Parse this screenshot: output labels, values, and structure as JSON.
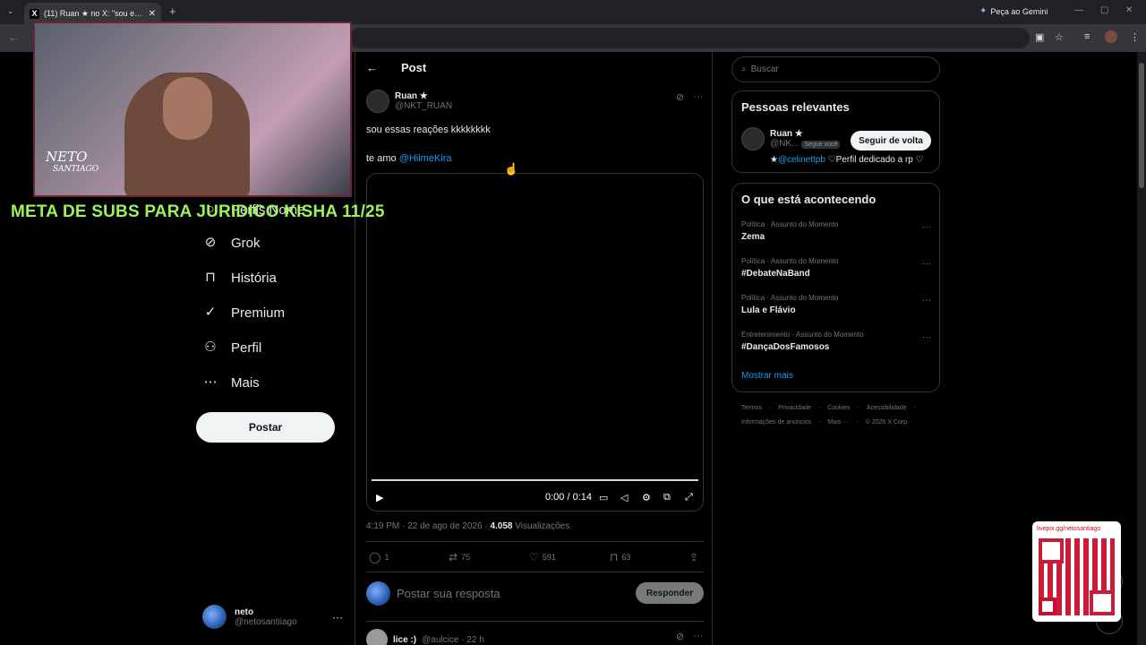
{
  "browser": {
    "tab_title": "(11) Ruan ★ no X: \"sou essas re",
    "tab_favicon": "X",
    "gemini_label": "Peça ao Gemini"
  },
  "overlay": {
    "banner": "META DE SUBS PARA JURIDICO KISHA 11/25",
    "webcam_logo_line1": "NETO",
    "webcam_logo_line2": "SANTIAGO",
    "qr_url": "livepix.gg/netosantiago"
  },
  "nav": {
    "items": [
      {
        "label": "Perfis Nome",
        "icon": "search-icon"
      },
      {
        "label": "Grok",
        "icon": "grok-icon"
      },
      {
        "label": "História",
        "icon": "bookmark-icon"
      },
      {
        "label": "Premium",
        "icon": "verified-icon"
      },
      {
        "label": "Perfil",
        "icon": "person-icon"
      },
      {
        "label": "Mais",
        "icon": "more-circle-icon"
      }
    ],
    "post_button": "Postar",
    "user_name": "neto",
    "user_handle": "@netosantiiago"
  },
  "post": {
    "header_title": "Post",
    "author_name": "Ruan ★",
    "author_handle": "@NKT_RUAN",
    "text_line1": "sou essas reações kkkkkkkk",
    "text_line2_prefix": "te amo ",
    "text_line2_mention": "@HiimeKira",
    "video_time": "0:00 / 0:14",
    "timestamp": "4:19 PM · 22 de ago de 2026 · ",
    "views_count": "4.058",
    "views_label": " Visualizações",
    "replies": "1",
    "reposts": "75",
    "likes": "591",
    "bookmarks": "63",
    "reply_placeholder": "Postar sua resposta",
    "reply_button": "Responder",
    "first_reply_name": "lice :)",
    "first_reply_handle": "@aulcice · 22 h"
  },
  "sidebar_right": {
    "search_placeholder": "Buscar",
    "relevant_title": "Pessoas relevantes",
    "rel_user_name": "Ruan ★",
    "rel_user_handle": "@NK...",
    "rel_user_follows": "Segue você",
    "follow_back": "Seguir de volta",
    "rel_bio_prefix": "★",
    "rel_bio_mention": "@celinettpb",
    "rel_bio_suffix": " ♡Perfil dedicado a rp ♡",
    "trending_title": "O que está acontecendo",
    "trends": [
      {
        "context": "Política · Assunto do Momento",
        "topic": "Zema"
      },
      {
        "context": "Política · Assunto do Momento",
        "topic": "#DebateNaBand"
      },
      {
        "context": "Política · Assunto do Momento",
        "topic": "Lula e Flávio"
      },
      {
        "context": "Entretenimento · Assunto do Momento",
        "topic": "#DançaDosFamosos"
      }
    ],
    "show_more": "Mostrar mais",
    "footer_line1": [
      "Termos",
      "Privacidade",
      "Cookies",
      "Acessibilidade"
    ],
    "footer_line2": [
      "Informações de anúncios",
      "Mais ···",
      "© 2026 X Corp."
    ]
  },
  "colors": {
    "accent": "#1d9bf0",
    "banner": "#9bf25b",
    "qr": "#c8102e"
  }
}
